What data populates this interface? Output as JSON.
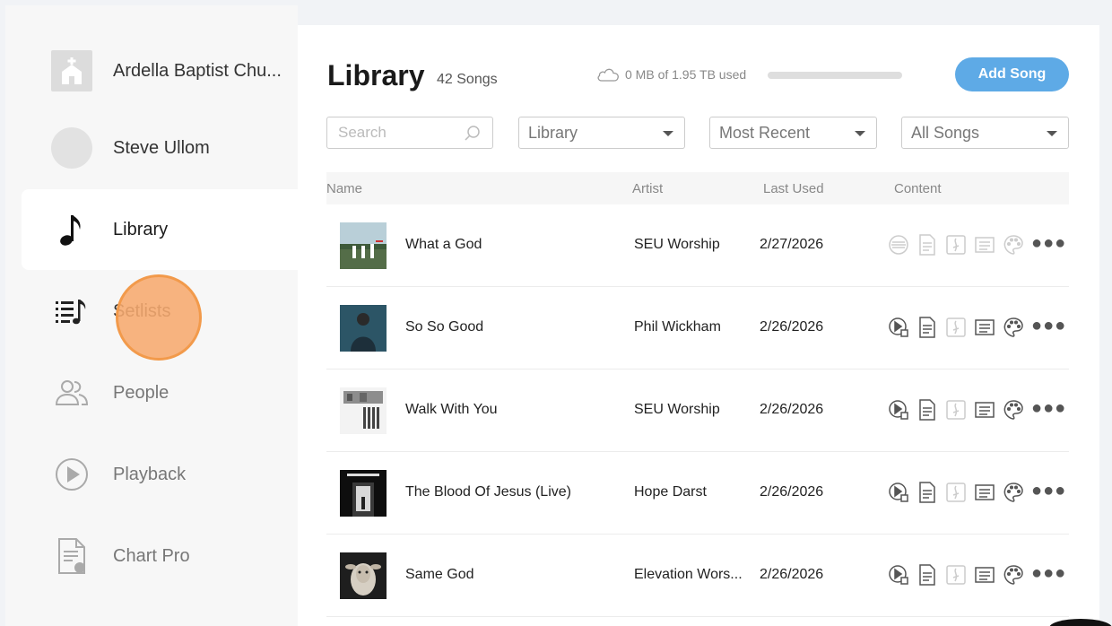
{
  "sidebar": {
    "church": "Ardella Baptist Chu...",
    "user": "Steve Ullom",
    "items": [
      {
        "label": "Library",
        "icon": "music-note-icon"
      },
      {
        "label": "Setlists",
        "icon": "setlist-icon"
      },
      {
        "label": "People",
        "icon": "people-icon"
      },
      {
        "label": "Playback",
        "icon": "play-circle-icon"
      },
      {
        "label": "Chart Pro",
        "icon": "chart-document-icon"
      }
    ]
  },
  "header": {
    "title": "Library",
    "count": "42 Songs",
    "storage_text": "0 MB of 1.95 TB used",
    "storage_fraction": 0.0,
    "add_button": "Add Song"
  },
  "filters": {
    "search_placeholder": "Search",
    "source": "Library",
    "sort": "Most Recent",
    "scope": "All Songs"
  },
  "table": {
    "columns": [
      "Name",
      "Artist",
      "Last Used",
      "Content"
    ],
    "rows": [
      {
        "name": "What a God",
        "artist": "SEU Worship",
        "last_used": "2/27/2026"
      },
      {
        "name": "So So Good",
        "artist": "Phil Wickham",
        "last_used": "2/26/2026"
      },
      {
        "name": "Walk With You",
        "artist": "SEU Worship",
        "last_used": "2/26/2026"
      },
      {
        "name": "The Blood Of Jesus (Live)",
        "artist": "Hope Darst",
        "last_used": "2/26/2026"
      },
      {
        "name": "Same God",
        "artist": "Elevation Wors...",
        "last_used": "2/26/2026"
      }
    ]
  },
  "colors": {
    "accent": "#5eaae6",
    "cursor": "#f29a4b"
  }
}
